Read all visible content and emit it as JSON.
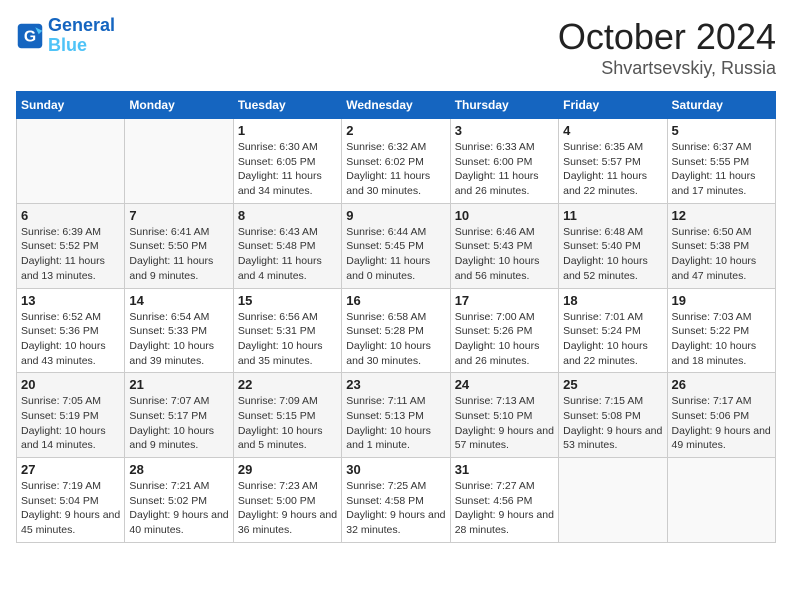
{
  "header": {
    "logo_line1": "General",
    "logo_line2": "Blue",
    "month": "October 2024",
    "location": "Shvartsevskiy, Russia"
  },
  "weekdays": [
    "Sunday",
    "Monday",
    "Tuesday",
    "Wednesday",
    "Thursday",
    "Friday",
    "Saturday"
  ],
  "weeks": [
    [
      {
        "day": "",
        "info": ""
      },
      {
        "day": "",
        "info": ""
      },
      {
        "day": "1",
        "info": "Sunrise: 6:30 AM\nSunset: 6:05 PM\nDaylight: 11 hours and 34 minutes."
      },
      {
        "day": "2",
        "info": "Sunrise: 6:32 AM\nSunset: 6:02 PM\nDaylight: 11 hours and 30 minutes."
      },
      {
        "day": "3",
        "info": "Sunrise: 6:33 AM\nSunset: 6:00 PM\nDaylight: 11 hours and 26 minutes."
      },
      {
        "day": "4",
        "info": "Sunrise: 6:35 AM\nSunset: 5:57 PM\nDaylight: 11 hours and 22 minutes."
      },
      {
        "day": "5",
        "info": "Sunrise: 6:37 AM\nSunset: 5:55 PM\nDaylight: 11 hours and 17 minutes."
      }
    ],
    [
      {
        "day": "6",
        "info": "Sunrise: 6:39 AM\nSunset: 5:52 PM\nDaylight: 11 hours and 13 minutes."
      },
      {
        "day": "7",
        "info": "Sunrise: 6:41 AM\nSunset: 5:50 PM\nDaylight: 11 hours and 9 minutes."
      },
      {
        "day": "8",
        "info": "Sunrise: 6:43 AM\nSunset: 5:48 PM\nDaylight: 11 hours and 4 minutes."
      },
      {
        "day": "9",
        "info": "Sunrise: 6:44 AM\nSunset: 5:45 PM\nDaylight: 11 hours and 0 minutes."
      },
      {
        "day": "10",
        "info": "Sunrise: 6:46 AM\nSunset: 5:43 PM\nDaylight: 10 hours and 56 minutes."
      },
      {
        "day": "11",
        "info": "Sunrise: 6:48 AM\nSunset: 5:40 PM\nDaylight: 10 hours and 52 minutes."
      },
      {
        "day": "12",
        "info": "Sunrise: 6:50 AM\nSunset: 5:38 PM\nDaylight: 10 hours and 47 minutes."
      }
    ],
    [
      {
        "day": "13",
        "info": "Sunrise: 6:52 AM\nSunset: 5:36 PM\nDaylight: 10 hours and 43 minutes."
      },
      {
        "day": "14",
        "info": "Sunrise: 6:54 AM\nSunset: 5:33 PM\nDaylight: 10 hours and 39 minutes."
      },
      {
        "day": "15",
        "info": "Sunrise: 6:56 AM\nSunset: 5:31 PM\nDaylight: 10 hours and 35 minutes."
      },
      {
        "day": "16",
        "info": "Sunrise: 6:58 AM\nSunset: 5:28 PM\nDaylight: 10 hours and 30 minutes."
      },
      {
        "day": "17",
        "info": "Sunrise: 7:00 AM\nSunset: 5:26 PM\nDaylight: 10 hours and 26 minutes."
      },
      {
        "day": "18",
        "info": "Sunrise: 7:01 AM\nSunset: 5:24 PM\nDaylight: 10 hours and 22 minutes."
      },
      {
        "day": "19",
        "info": "Sunrise: 7:03 AM\nSunset: 5:22 PM\nDaylight: 10 hours and 18 minutes."
      }
    ],
    [
      {
        "day": "20",
        "info": "Sunrise: 7:05 AM\nSunset: 5:19 PM\nDaylight: 10 hours and 14 minutes."
      },
      {
        "day": "21",
        "info": "Sunrise: 7:07 AM\nSunset: 5:17 PM\nDaylight: 10 hours and 9 minutes."
      },
      {
        "day": "22",
        "info": "Sunrise: 7:09 AM\nSunset: 5:15 PM\nDaylight: 10 hours and 5 minutes."
      },
      {
        "day": "23",
        "info": "Sunrise: 7:11 AM\nSunset: 5:13 PM\nDaylight: 10 hours and 1 minute."
      },
      {
        "day": "24",
        "info": "Sunrise: 7:13 AM\nSunset: 5:10 PM\nDaylight: 9 hours and 57 minutes."
      },
      {
        "day": "25",
        "info": "Sunrise: 7:15 AM\nSunset: 5:08 PM\nDaylight: 9 hours and 53 minutes."
      },
      {
        "day": "26",
        "info": "Sunrise: 7:17 AM\nSunset: 5:06 PM\nDaylight: 9 hours and 49 minutes."
      }
    ],
    [
      {
        "day": "27",
        "info": "Sunrise: 7:19 AM\nSunset: 5:04 PM\nDaylight: 9 hours and 45 minutes."
      },
      {
        "day": "28",
        "info": "Sunrise: 7:21 AM\nSunset: 5:02 PM\nDaylight: 9 hours and 40 minutes."
      },
      {
        "day": "29",
        "info": "Sunrise: 7:23 AM\nSunset: 5:00 PM\nDaylight: 9 hours and 36 minutes."
      },
      {
        "day": "30",
        "info": "Sunrise: 7:25 AM\nSunset: 4:58 PM\nDaylight: 9 hours and 32 minutes."
      },
      {
        "day": "31",
        "info": "Sunrise: 7:27 AM\nSunset: 4:56 PM\nDaylight: 9 hours and 28 minutes."
      },
      {
        "day": "",
        "info": ""
      },
      {
        "day": "",
        "info": ""
      }
    ]
  ]
}
